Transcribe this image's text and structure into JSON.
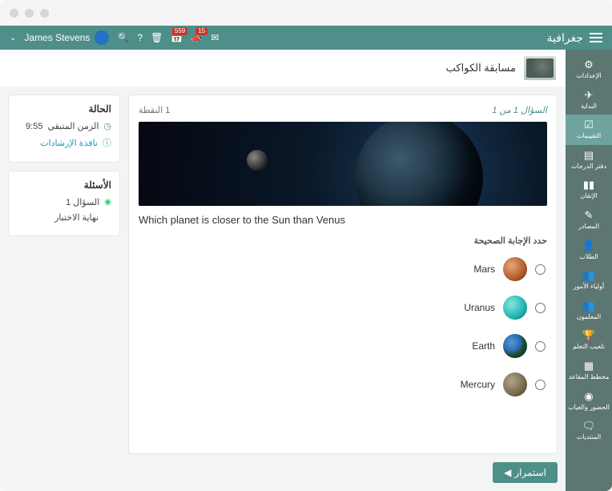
{
  "topbar": {
    "brand": "جغرافية",
    "user_name": "James Stevens",
    "badge_cal": "559",
    "badge_bell": "15"
  },
  "page": {
    "title": "مسابقة الكواكب"
  },
  "status_card": {
    "title": "الحالة",
    "time_label": "الزمن المتبقي",
    "time_value": "9:55",
    "instructions": "نافذة الإرشادات"
  },
  "questions_card": {
    "title": "الأسئلة",
    "q1": "السؤال 1",
    "end": "نهاية الاختبار"
  },
  "question": {
    "counter": "السؤال 1 من 1",
    "points": "1 النقطة",
    "text": "Which planet is closer to the Sun than Venus",
    "instruction": "حدد الإجابة الصحيحة",
    "options": [
      {
        "label": "Mars",
        "cls": "mars"
      },
      {
        "label": "Uranus",
        "cls": "uranus"
      },
      {
        "label": "Earth",
        "cls": "earth"
      },
      {
        "label": "Mercury",
        "cls": "mercury"
      }
    ]
  },
  "sidebar": {
    "items": [
      {
        "icon": "⚙",
        "label": "الإعدادات"
      },
      {
        "icon": "✈",
        "label": "البداية"
      },
      {
        "icon": "☑",
        "label": "التقييمات"
      },
      {
        "icon": "▤",
        "label": "دفتر الدرجات"
      },
      {
        "icon": "▮▮",
        "label": "الإتقان"
      },
      {
        "icon": "✎",
        "label": "المصادر"
      },
      {
        "icon": "👤",
        "label": "الطلاب"
      },
      {
        "icon": "👥",
        "label": "أولياء الأمور"
      },
      {
        "icon": "👥",
        "label": "المعلمون"
      },
      {
        "icon": "🏆",
        "label": "تلعيب التعلم"
      },
      {
        "icon": "▦",
        "label": "مخطط المقاعد"
      },
      {
        "icon": "◉",
        "label": "الحضور والغياب"
      },
      {
        "icon": "🗨",
        "label": "المنتديات"
      }
    ]
  },
  "continue_label": "استمرار"
}
